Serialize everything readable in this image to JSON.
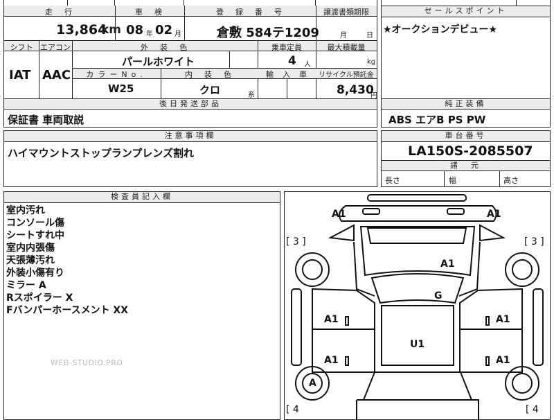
{
  "spec": {
    "labels": {
      "mileage": "走　行",
      "inspection": "車　検",
      "registration": "登　録　番　号",
      "transfer": "譲渡書類期限",
      "shift": "シフト",
      "aircon": "エアコン",
      "exterior_color": "外　装　色",
      "capacity": "乗車定員",
      "max_load": "最大積載量",
      "color_no": "カラーNo.",
      "interior_color": "内　装　色",
      "import": "輸　入　車",
      "recycle": "リサイクル預託金"
    },
    "mileage_value": "13,864",
    "mileage_unit": "km",
    "inspection_year": "08",
    "year_unit": "年",
    "inspection_month": "02",
    "month_unit": "月",
    "registration_value": "倉敷 584テ1209",
    "transfer_month_unit": "月",
    "transfer_day_unit": "日",
    "shift_value": "IAT",
    "aircon_value": "AAC",
    "exterior_color_value": "パールホワイト",
    "capacity_value": "4",
    "capacity_unit": "人",
    "max_load_unit": "kg",
    "color_no_value": "W25",
    "interior_color_value": "クロ",
    "interior_suffix": "系",
    "recycle_value": "8,430",
    "recycle_unit": "円"
  },
  "sales_point": {
    "header": "セールスポイント",
    "text": "★オークションデビュー★"
  },
  "later_parts": {
    "header": "後日発送部品",
    "text": "保証書 車両取説"
  },
  "genuine_equipment": {
    "header": "純正装備",
    "text": "ABS エアB PS PW"
  },
  "notes": {
    "header": "注意事項欄",
    "text": "ハイマウントストップランプレンズ割れ"
  },
  "chassis": {
    "header": "車台番号",
    "number": "LA150S-2085507",
    "dimensions_header": "諸　元",
    "length_label": "長さ",
    "width_label": "幅",
    "height_label": "高さ"
  },
  "inspector": {
    "header": "検査員記入欄",
    "lines": [
      "室内汚れ",
      "コンソール傷",
      "シートすれ中",
      "室内内張傷",
      "天張薄汚れ",
      "外装小傷有り",
      "ミラー A",
      "Rスポイラー X",
      "Fバンパーホースメント XX"
    ]
  },
  "watermark": "WEB-STUDIO.PRO",
  "diagram": {
    "marks": {
      "front_left": "A1",
      "front_right": "A1",
      "left_bracket": "[ 3 ]",
      "right_bracket": "[ 3 ]",
      "hood": "A1",
      "roof": "G",
      "left_front_door": "A1",
      "right_front_door": "A1",
      "center": "U1",
      "left_rear_door": "A1",
      "right_rear_door": "A1",
      "left_rear_wheel": "A",
      "left_bottom_bracket": "[ 4",
      "right_bottom_bracket": "[ 4"
    }
  }
}
